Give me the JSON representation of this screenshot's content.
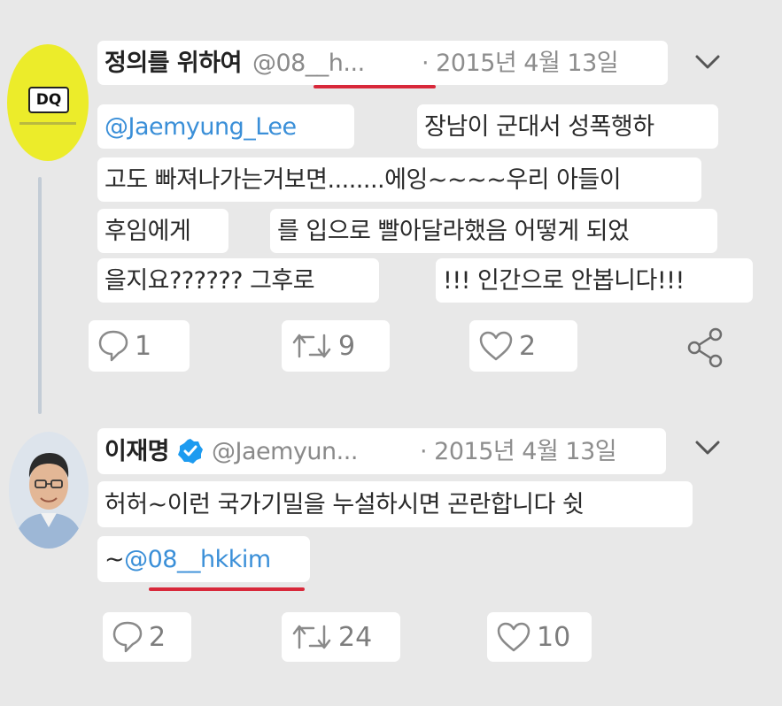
{
  "tweet1": {
    "avatar_text": "DQ",
    "display_name": "정의를 위하여",
    "handle": "@08__h...",
    "date": "· 2015년 4월 13일",
    "mention": "@Jaemyung_Lee",
    "line1_right": "장남이 군대서 성폭행하",
    "line2": "고도 빠져나가는거보면........에잉~~~~우리 아들이",
    "line3_left": "후임에게",
    "line3_right": "를 입으로 빨아달라했음 어떻게 되었",
    "line4_left": "을지요?????? 그후로",
    "line4_right": "!!!  인간으로 안봅니다!!!",
    "replies": "1",
    "retweets": "9",
    "likes": "2"
  },
  "tweet2": {
    "display_name": "이재명",
    "handle": "@Jaemyun...",
    "date": "· 2015년 4월 13일",
    "line1": "허허~이런 국가기밀을 누설하시면 곤란합니다 쉿",
    "line2_prefix": "~",
    "line2_mention": "@08__hkkim",
    "replies": "2",
    "retweets": "24",
    "likes": "10"
  },
  "colors": {
    "background": "#e8e8e8",
    "link": "#3a8fd8",
    "highlight_underline": "#d8283a",
    "verified": "#1d9bf0",
    "avatar1_bg": "#ecec2a"
  },
  "icons": [
    "reply-icon",
    "retweet-icon",
    "like-icon",
    "share-icon",
    "chevron-down-icon",
    "verified-badge-icon"
  ]
}
